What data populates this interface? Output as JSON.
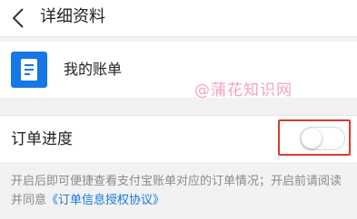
{
  "header": {
    "back_icon": "chevron-left-icon",
    "title": "详细资料"
  },
  "bill": {
    "icon": "bill-document-icon",
    "label": "我的账单"
  },
  "watermark": "@蒲花知识网",
  "order_progress": {
    "label": "订单进度",
    "toggle_state": "off",
    "highlight_color": "#d63a2e"
  },
  "description": {
    "text": "开启后即可便捷查看支付宝账单对应的订单情况；开启前请阅读并同意",
    "link": "《订单信息授权协议》"
  },
  "colors": {
    "accent": "#1677e6",
    "background": "#f2f2f2"
  }
}
